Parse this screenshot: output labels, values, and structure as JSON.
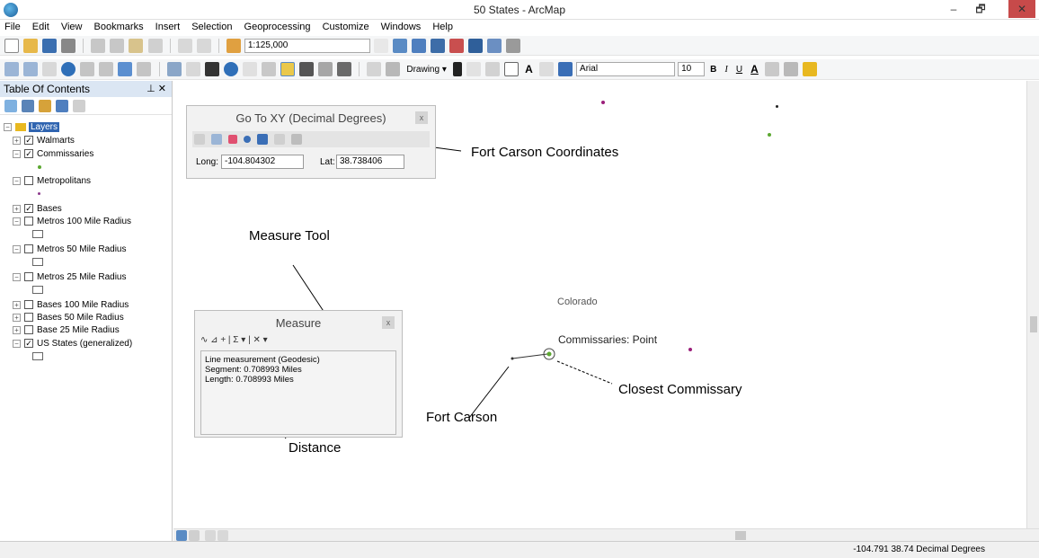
{
  "window": {
    "title": "50 States - ArcMap",
    "min": "–",
    "max": "🗗",
    "close": "✕"
  },
  "menu": [
    "File",
    "Edit",
    "View",
    "Bookmarks",
    "Insert",
    "Selection",
    "Geoprocessing",
    "Customize",
    "Windows",
    "Help"
  ],
  "toolbar": {
    "scale": "1:125,000",
    "drawing": "Drawing ▾",
    "font": "Arial",
    "font_size": "10",
    "bold": "B",
    "italic": "I",
    "underline": "U",
    "text_a": "A",
    "text_a2": "A"
  },
  "toc": {
    "title": "Table Of Contents",
    "pin": "⊥ ✕",
    "root": "Layers",
    "layers": [
      {
        "label": "Walmarts",
        "expand": "+",
        "check": "✓"
      },
      {
        "label": "Commissaries",
        "expand": "−",
        "check": "✓"
      },
      {
        "label": "Metropolitans",
        "expand": "−",
        "check": ""
      },
      {
        "label": "Bases",
        "expand": "+",
        "check": "✓"
      },
      {
        "label": "Metros 100 Mile Radius",
        "expand": "−",
        "check": ""
      },
      {
        "label": "Metros 50 Mile Radius",
        "expand": "−",
        "check": ""
      },
      {
        "label": "Metros 25 Mile Radius",
        "expand": "−",
        "check": ""
      },
      {
        "label": "Bases 100 Mile Radius",
        "expand": "+",
        "check": ""
      },
      {
        "label": "Bases 50 Mile Radius",
        "expand": "+",
        "check": ""
      },
      {
        "label": "Base 25 Mile Radius",
        "expand": "+",
        "check": ""
      },
      {
        "label": "US States (generalized)",
        "expand": "−",
        "check": "✓"
      }
    ]
  },
  "goto": {
    "title": "Go To XY   (Decimal Degrees)",
    "close": "x",
    "long_label": "Long:",
    "long_value": "-104.804302",
    "lat_label": "Lat:",
    "lat_value": "38.738406"
  },
  "measure": {
    "title": "Measure",
    "close": "x",
    "tools": "∿  ⊿  +  |  Σ ▾  |  ✕ ▾",
    "line1": "Line measurement (Geodesic)",
    "line2": "Segment: 0.708993 Miles",
    "line3": "Length: 0.708993 Miles"
  },
  "annotations": {
    "fort_carson_coords": "Fort Carson Coordinates",
    "measure_tool": "Measure Tool",
    "distance": "Distance",
    "fort_carson": "Fort Carson",
    "closest_commissary": "Closest Commissary"
  },
  "map": {
    "state_label": "Colorado",
    "feature_label": "Commissaries: Point"
  },
  "status": {
    "coords": "-104.791  38.74 Decimal Degrees"
  },
  "colors": {
    "purple": "#9b1f7a",
    "green": "#5ca831",
    "accent": "#dbe6f3"
  }
}
